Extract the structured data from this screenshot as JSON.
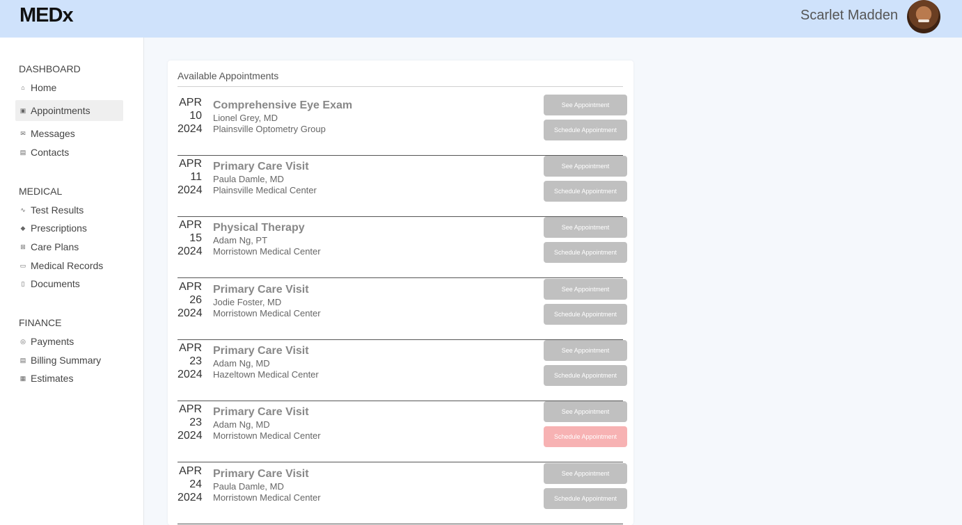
{
  "app": {
    "logo": "MEDx"
  },
  "user": {
    "name": "Scarlet Madden"
  },
  "sidebar": {
    "sections": [
      {
        "title": "DASHBOARD"
      },
      {
        "title": "MEDICAL"
      },
      {
        "title": "FINANCE"
      }
    ],
    "items": [
      {
        "label": "Home",
        "icon": "home-icon"
      },
      {
        "label": "Appointments",
        "icon": "calendar-icon",
        "active": true
      },
      {
        "label": "Messages",
        "icon": "mail-icon"
      },
      {
        "label": "Contacts",
        "icon": "id-card-icon"
      },
      {
        "label": "Test Results",
        "icon": "pulse-icon"
      },
      {
        "label": "Prescriptions",
        "icon": "pill-icon"
      },
      {
        "label": "Care Plans",
        "icon": "sitemap-icon"
      },
      {
        "label": "Medical Records",
        "icon": "folder-icon"
      },
      {
        "label": "Documents",
        "icon": "document-icon"
      },
      {
        "label": "Payments",
        "icon": "dollar-icon"
      },
      {
        "label": "Billing Summary",
        "icon": "receipt-icon"
      },
      {
        "label": "Estimates",
        "icon": "calculator-icon"
      }
    ]
  },
  "main": {
    "card_title": "Available Appointments",
    "see_label": "See Appointment",
    "schedule_label": "Schedule Appointment",
    "appointments": [
      {
        "month": "APR",
        "day": "10",
        "year": "2024",
        "title": "Comprehensive Eye Exam",
        "provider": "Lionel Grey, MD",
        "location": "Plainsville Optometry Group"
      },
      {
        "month": "APR",
        "day": "11",
        "year": "2024",
        "title": "Primary Care Visit",
        "provider": "Paula Damle, MD",
        "location": "Plainsville Medical Center"
      },
      {
        "month": "APR",
        "day": "15",
        "year": "2024",
        "title": "Physical Therapy",
        "provider": "Adam Ng, PT",
        "location": "Morristown Medical Center"
      },
      {
        "month": "APR",
        "day": "26",
        "year": "2024",
        "title": "Primary Care Visit",
        "provider": "Jodie Foster, MD",
        "location": "Morristown Medical Center"
      },
      {
        "month": "APR",
        "day": "23",
        "year": "2024",
        "title": "Primary Care Visit",
        "provider": "Adam Ng, MD",
        "location": "Hazeltown Medical Center"
      },
      {
        "month": "APR",
        "day": "23",
        "year": "2024",
        "title": "Primary Care Visit",
        "provider": "Adam Ng, MD",
        "location": "Morristown Medical Center"
      },
      {
        "month": "APR",
        "day": "24",
        "year": "2024",
        "title": "Primary Care Visit",
        "provider": "Paula Damle, MD",
        "location": "Morristown Medical Center"
      }
    ]
  },
  "colors": {
    "header_bg": "#cfe2fb",
    "button_gray": "#c0c0c0",
    "button_alert": "#f7b2b3"
  }
}
